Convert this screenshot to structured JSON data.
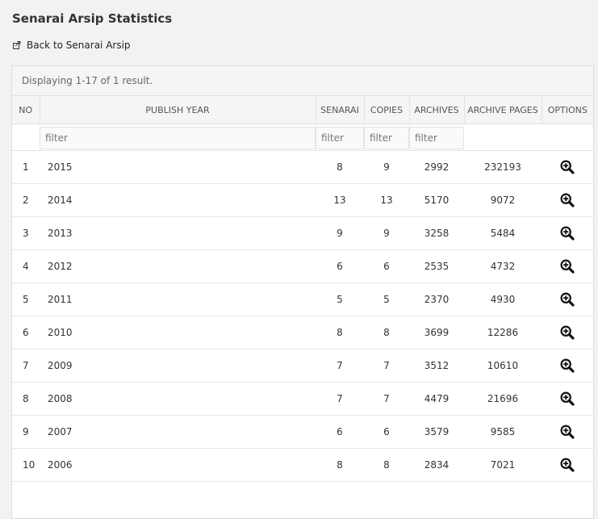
{
  "page": {
    "title": "Senarai Arsip Statistics",
    "back_label": "Back to Senarai Arsip"
  },
  "grid": {
    "summary": "Displaying 1-17 of 1 result.",
    "columns": {
      "no": "NO",
      "publish_year": "PUBLISH YEAR",
      "senarai": "SENARAI",
      "copies": "COPIES",
      "archives": "ARCHIVES",
      "archive_pages": "ARCHIVE PAGES",
      "options": "OPTIONS"
    },
    "filter_placeholder": "filter",
    "rows": [
      {
        "no": "1",
        "year": "2015",
        "senarai": "8",
        "copies": "9",
        "archives": "2992",
        "pages": "232193"
      },
      {
        "no": "2",
        "year": "2014",
        "senarai": "13",
        "copies": "13",
        "archives": "5170",
        "pages": "9072"
      },
      {
        "no": "3",
        "year": "2013",
        "senarai": "9",
        "copies": "9",
        "archives": "3258",
        "pages": "5484"
      },
      {
        "no": "4",
        "year": "2012",
        "senarai": "6",
        "copies": "6",
        "archives": "2535",
        "pages": "4732"
      },
      {
        "no": "5",
        "year": "2011",
        "senarai": "5",
        "copies": "5",
        "archives": "2370",
        "pages": "4930"
      },
      {
        "no": "6",
        "year": "2010",
        "senarai": "8",
        "copies": "8",
        "archives": "3699",
        "pages": "12286"
      },
      {
        "no": "7",
        "year": "2009",
        "senarai": "7",
        "copies": "7",
        "archives": "3512",
        "pages": "10610"
      },
      {
        "no": "8",
        "year": "2008",
        "senarai": "7",
        "copies": "7",
        "archives": "4479",
        "pages": "21696"
      },
      {
        "no": "9",
        "year": "2007",
        "senarai": "6",
        "copies": "6",
        "archives": "3579",
        "pages": "9585"
      },
      {
        "no": "10",
        "year": "2006",
        "senarai": "8",
        "copies": "8",
        "archives": "2834",
        "pages": "7021"
      }
    ],
    "row_action_icon": "zoom-in-icon"
  }
}
